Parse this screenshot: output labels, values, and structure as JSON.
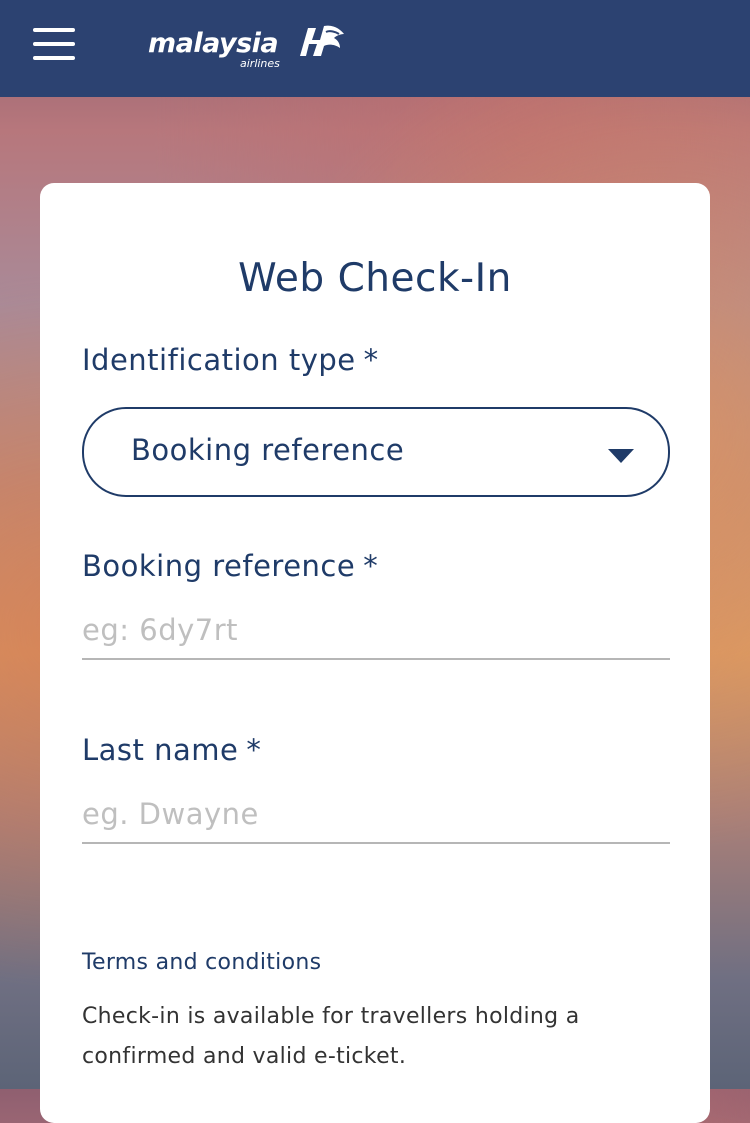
{
  "header": {
    "menu_icon": "hamburger-menu-icon",
    "logo": {
      "word": "malaysia",
      "sub": "airlines",
      "mark_icon": "malaysia-airlines-kite-logo"
    },
    "background_color": "#2c4271"
  },
  "form": {
    "title": "Web Check-In",
    "identification": {
      "label": "Identification type",
      "required_marker": "*",
      "selected_value": "Booking reference",
      "caret_icon": "caret-down-icon"
    },
    "booking_reference": {
      "label": "Booking reference",
      "required_marker": "*",
      "placeholder": "eg: 6dy7rt",
      "value": ""
    },
    "last_name": {
      "label": "Last name",
      "required_marker": "*",
      "placeholder": "eg. Dwayne",
      "value": ""
    },
    "terms": {
      "title": "Terms and conditions",
      "body": "Check-in is available for travellers holding a confirmed and valid e-ticket."
    }
  },
  "colors": {
    "brand_navy": "#1f3b68",
    "header_navy": "#2c4271",
    "placeholder_gray": "#bfbfbf"
  }
}
